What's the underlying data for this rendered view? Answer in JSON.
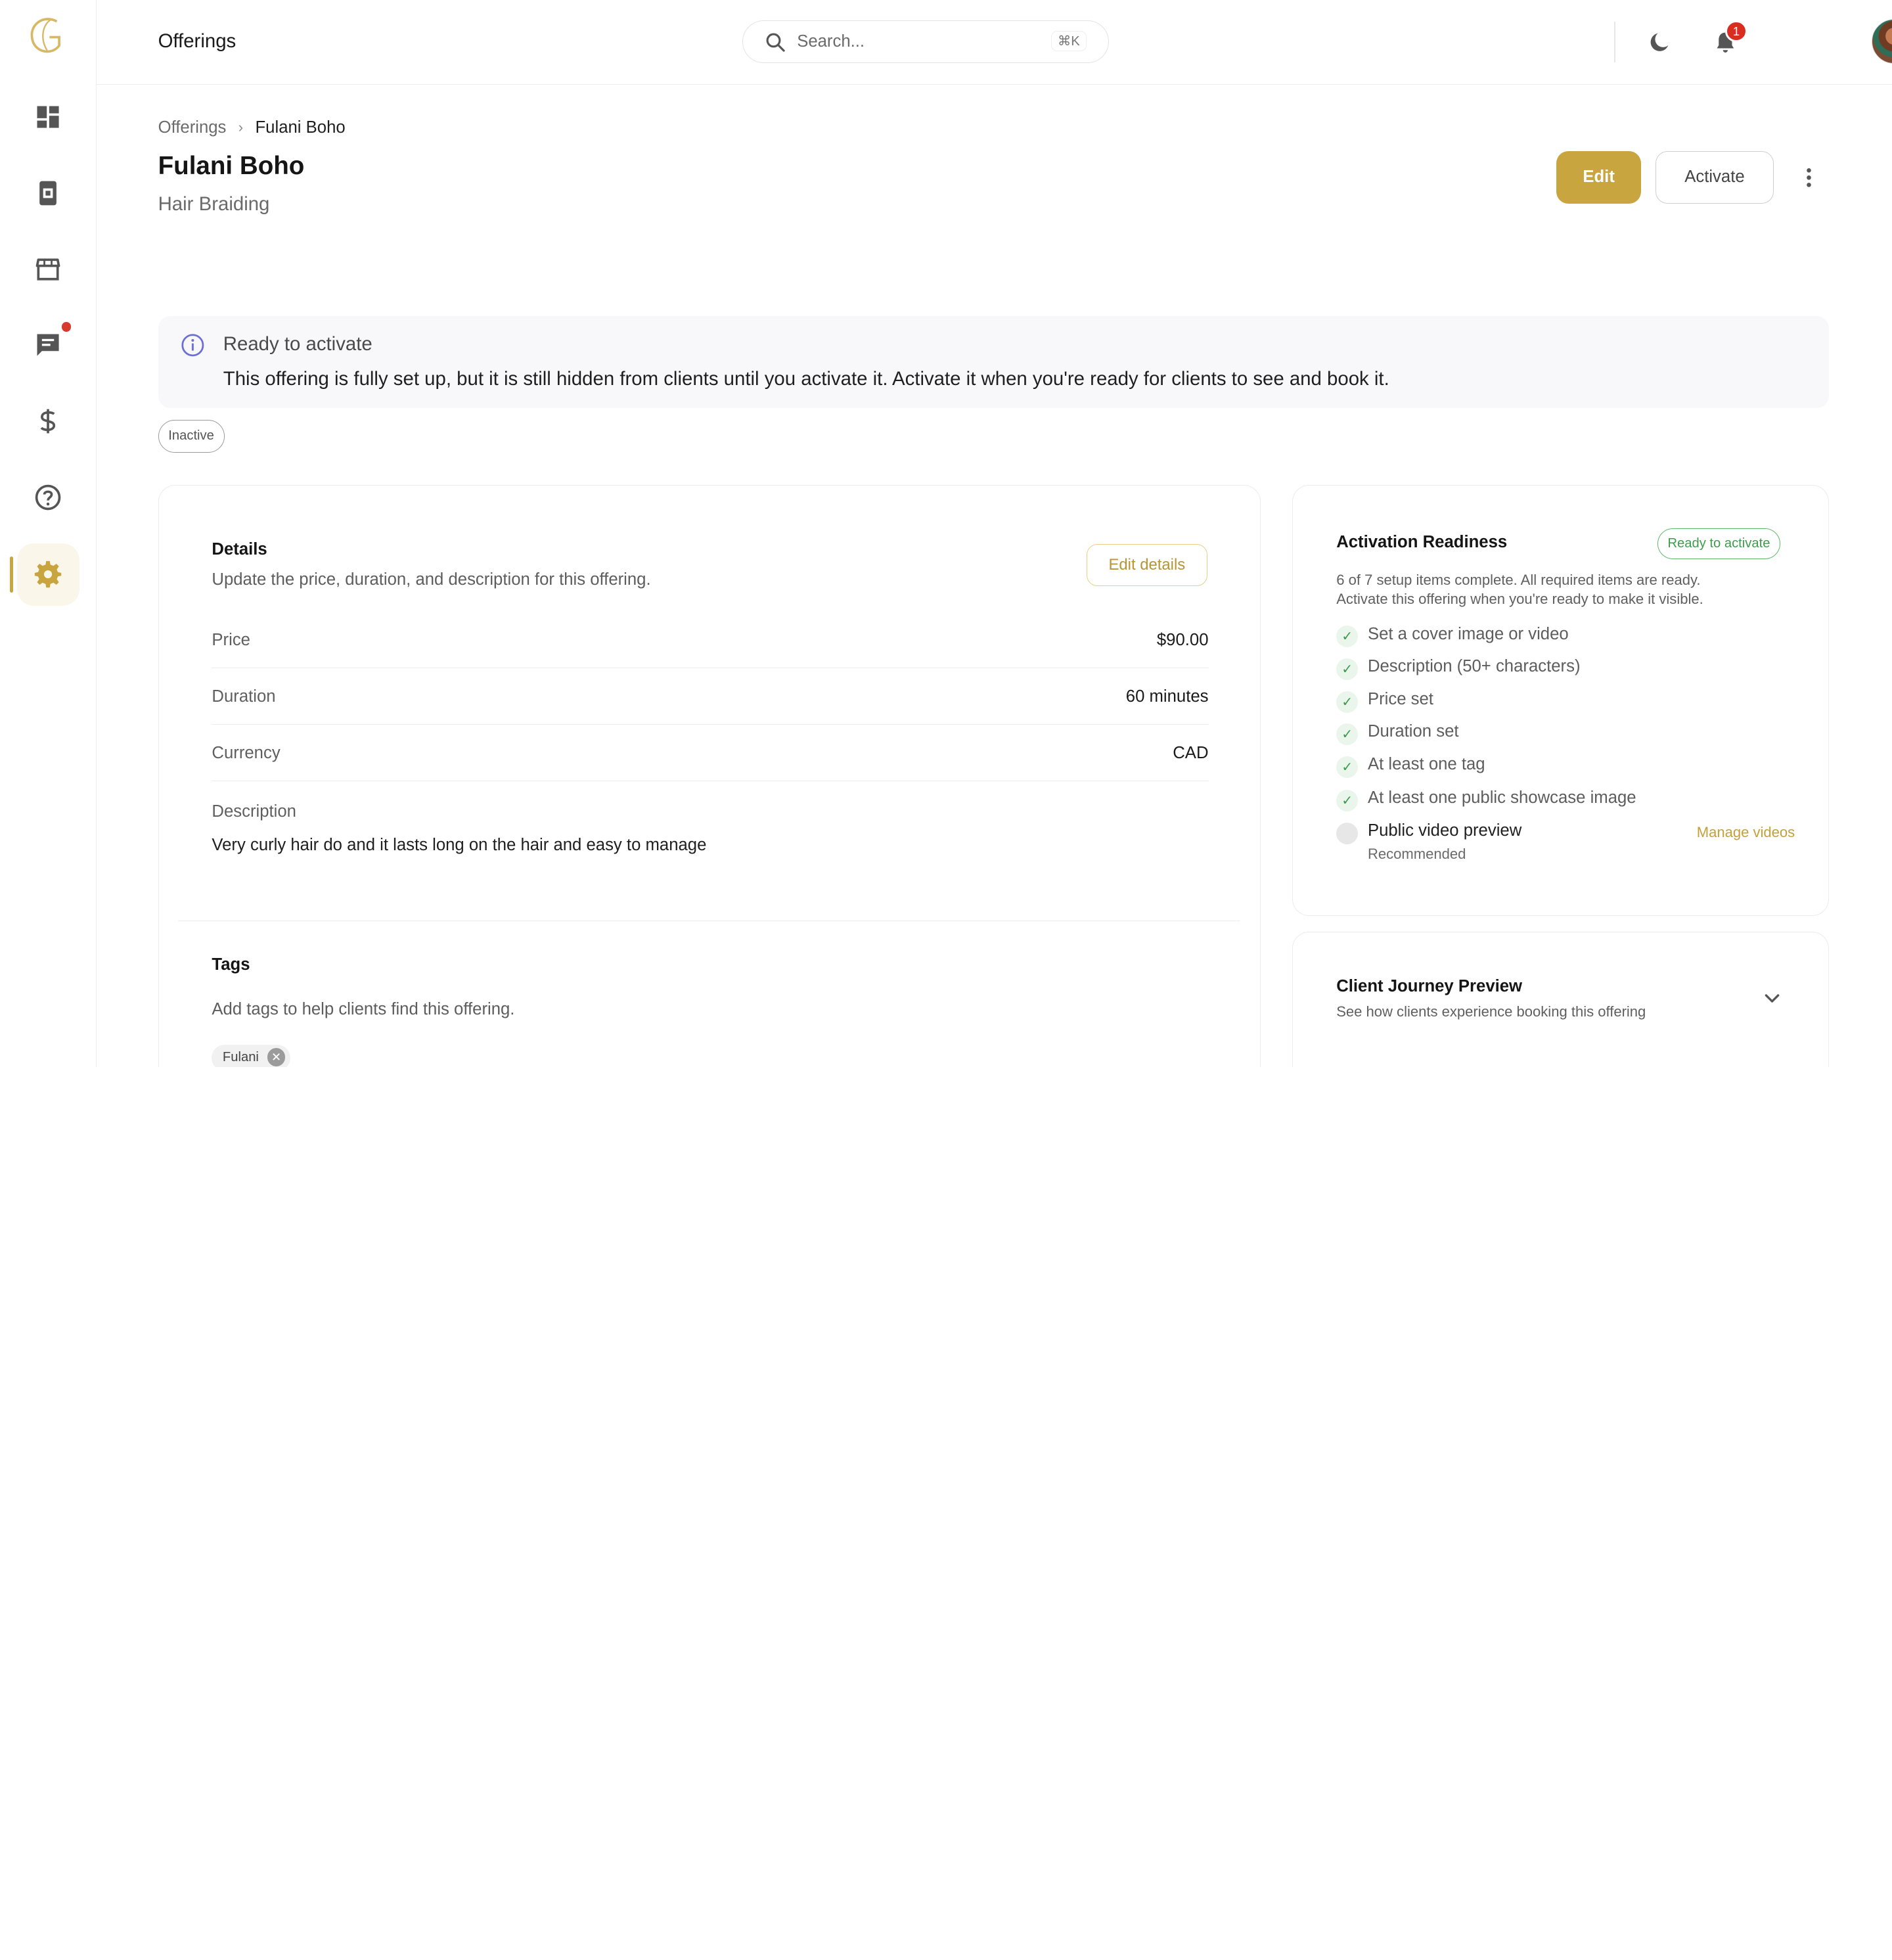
{
  "topbar": {
    "title": "Offerings",
    "search_placeholder": "Search...",
    "search_shortcut": "⌘K",
    "notification_count": "1"
  },
  "sidebar": {
    "items": [
      {
        "name": "dashboard",
        "icon": "dashboard-icon"
      },
      {
        "name": "bookings",
        "icon": "booking-icon"
      },
      {
        "name": "store",
        "icon": "store-icon"
      },
      {
        "name": "messages",
        "icon": "chat-icon",
        "has_dot": true
      },
      {
        "name": "payments",
        "icon": "dollar-icon"
      },
      {
        "name": "help",
        "icon": "help-icon"
      },
      {
        "name": "settings",
        "icon": "gear-icon",
        "active": true
      }
    ]
  },
  "page": {
    "breadcrumb": [
      "Offerings",
      "Fulani Boho"
    ],
    "title": "Fulani Boho",
    "subtitle": "Hair Braiding",
    "edit_label": "Edit",
    "activate_label": "Activate"
  },
  "banner": {
    "title": "Ready to activate",
    "text": "This offering is fully set up, but it is still hidden from clients until you activate it. Activate it when you're ready for clients to see and book it."
  },
  "status": "Inactive",
  "details": {
    "title": "Details",
    "description": "Update the price, duration, and description for this offering.",
    "edit_label": "Edit details",
    "rows": [
      {
        "label": "Price",
        "value": "$90.00"
      },
      {
        "label": "Duration",
        "value": "60 minutes"
      },
      {
        "label": "Currency",
        "value": "CAD"
      }
    ],
    "desc_label": "Description",
    "desc_text": "Very curly hair do and it lasts long on the hair and easy to manage"
  },
  "tags": {
    "title": "Tags",
    "description": "Add tags to help clients find this offering.",
    "items": [
      "Fulani"
    ]
  },
  "readiness": {
    "title": "Activation Readiness",
    "badge": "Ready to activate",
    "summary_line1": "6 of 7 setup items complete. All required items are ready.",
    "summary_line2": "Activate this offering when you're ready to make it visible.",
    "items": [
      {
        "label": "Set a cover image or video",
        "done": true
      },
      {
        "label": "Description (50+ characters)",
        "done": true
      },
      {
        "label": "Price set",
        "done": true
      },
      {
        "label": "Duration set",
        "done": true
      },
      {
        "label": "At least one tag",
        "done": true
      },
      {
        "label": "At least one public showcase image",
        "done": true
      }
    ],
    "optional": {
      "label": "Public video preview",
      "sub": "Recommended",
      "link": "Manage videos",
      "done": false
    }
  },
  "journey": {
    "title": "Client Journey Preview",
    "description": "See how clients experience booking this offering"
  },
  "colors": {
    "brand_gold": "#c9a53f",
    "success_green": "#3e9c4a",
    "alert_red": "#d92d20"
  }
}
